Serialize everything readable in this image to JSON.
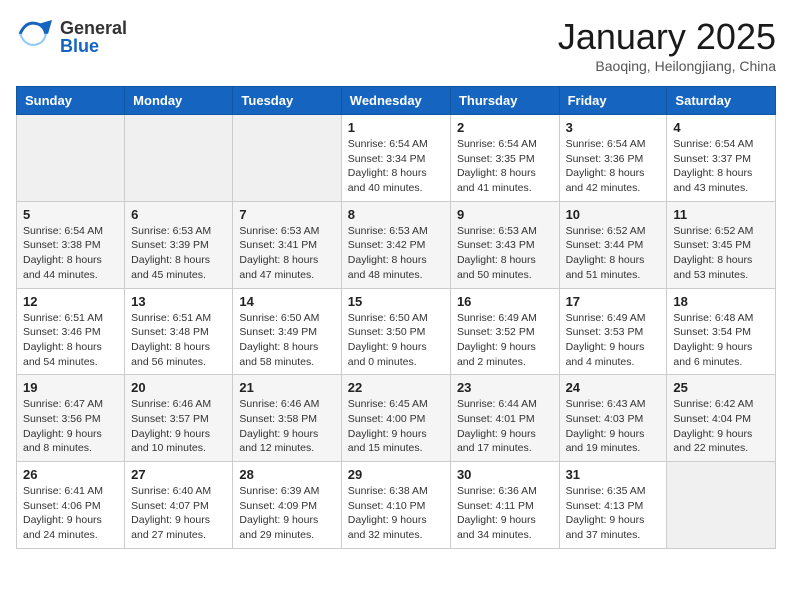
{
  "header": {
    "logo_general": "General",
    "logo_blue": "Blue",
    "month_title": "January 2025",
    "location": "Baoqing, Heilongjiang, China"
  },
  "days_of_week": [
    "Sunday",
    "Monday",
    "Tuesday",
    "Wednesday",
    "Thursday",
    "Friday",
    "Saturday"
  ],
  "weeks": [
    [
      {
        "day": "",
        "empty": true
      },
      {
        "day": "",
        "empty": true
      },
      {
        "day": "",
        "empty": true
      },
      {
        "day": "1",
        "sunrise": "6:54 AM",
        "sunset": "3:34 PM",
        "daylight": "8 hours and 40 minutes."
      },
      {
        "day": "2",
        "sunrise": "6:54 AM",
        "sunset": "3:35 PM",
        "daylight": "8 hours and 41 minutes."
      },
      {
        "day": "3",
        "sunrise": "6:54 AM",
        "sunset": "3:36 PM",
        "daylight": "8 hours and 42 minutes."
      },
      {
        "day": "4",
        "sunrise": "6:54 AM",
        "sunset": "3:37 PM",
        "daylight": "8 hours and 43 minutes."
      }
    ],
    [
      {
        "day": "5",
        "sunrise": "6:54 AM",
        "sunset": "3:38 PM",
        "daylight": "8 hours and 44 minutes."
      },
      {
        "day": "6",
        "sunrise": "6:53 AM",
        "sunset": "3:39 PM",
        "daylight": "8 hours and 45 minutes."
      },
      {
        "day": "7",
        "sunrise": "6:53 AM",
        "sunset": "3:41 PM",
        "daylight": "8 hours and 47 minutes."
      },
      {
        "day": "8",
        "sunrise": "6:53 AM",
        "sunset": "3:42 PM",
        "daylight": "8 hours and 48 minutes."
      },
      {
        "day": "9",
        "sunrise": "6:53 AM",
        "sunset": "3:43 PM",
        "daylight": "8 hours and 50 minutes."
      },
      {
        "day": "10",
        "sunrise": "6:52 AM",
        "sunset": "3:44 PM",
        "daylight": "8 hours and 51 minutes."
      },
      {
        "day": "11",
        "sunrise": "6:52 AM",
        "sunset": "3:45 PM",
        "daylight": "8 hours and 53 minutes."
      }
    ],
    [
      {
        "day": "12",
        "sunrise": "6:51 AM",
        "sunset": "3:46 PM",
        "daylight": "8 hours and 54 minutes."
      },
      {
        "day": "13",
        "sunrise": "6:51 AM",
        "sunset": "3:48 PM",
        "daylight": "8 hours and 56 minutes."
      },
      {
        "day": "14",
        "sunrise": "6:50 AM",
        "sunset": "3:49 PM",
        "daylight": "8 hours and 58 minutes."
      },
      {
        "day": "15",
        "sunrise": "6:50 AM",
        "sunset": "3:50 PM",
        "daylight": "9 hours and 0 minutes."
      },
      {
        "day": "16",
        "sunrise": "6:49 AM",
        "sunset": "3:52 PM",
        "daylight": "9 hours and 2 minutes."
      },
      {
        "day": "17",
        "sunrise": "6:49 AM",
        "sunset": "3:53 PM",
        "daylight": "9 hours and 4 minutes."
      },
      {
        "day": "18",
        "sunrise": "6:48 AM",
        "sunset": "3:54 PM",
        "daylight": "9 hours and 6 minutes."
      }
    ],
    [
      {
        "day": "19",
        "sunrise": "6:47 AM",
        "sunset": "3:56 PM",
        "daylight": "9 hours and 8 minutes."
      },
      {
        "day": "20",
        "sunrise": "6:46 AM",
        "sunset": "3:57 PM",
        "daylight": "9 hours and 10 minutes."
      },
      {
        "day": "21",
        "sunrise": "6:46 AM",
        "sunset": "3:58 PM",
        "daylight": "9 hours and 12 minutes."
      },
      {
        "day": "22",
        "sunrise": "6:45 AM",
        "sunset": "4:00 PM",
        "daylight": "9 hours and 15 minutes."
      },
      {
        "day": "23",
        "sunrise": "6:44 AM",
        "sunset": "4:01 PM",
        "daylight": "9 hours and 17 minutes."
      },
      {
        "day": "24",
        "sunrise": "6:43 AM",
        "sunset": "4:03 PM",
        "daylight": "9 hours and 19 minutes."
      },
      {
        "day": "25",
        "sunrise": "6:42 AM",
        "sunset": "4:04 PM",
        "daylight": "9 hours and 22 minutes."
      }
    ],
    [
      {
        "day": "26",
        "sunrise": "6:41 AM",
        "sunset": "4:06 PM",
        "daylight": "9 hours and 24 minutes."
      },
      {
        "day": "27",
        "sunrise": "6:40 AM",
        "sunset": "4:07 PM",
        "daylight": "9 hours and 27 minutes."
      },
      {
        "day": "28",
        "sunrise": "6:39 AM",
        "sunset": "4:09 PM",
        "daylight": "9 hours and 29 minutes."
      },
      {
        "day": "29",
        "sunrise": "6:38 AM",
        "sunset": "4:10 PM",
        "daylight": "9 hours and 32 minutes."
      },
      {
        "day": "30",
        "sunrise": "6:36 AM",
        "sunset": "4:11 PM",
        "daylight": "9 hours and 34 minutes."
      },
      {
        "day": "31",
        "sunrise": "6:35 AM",
        "sunset": "4:13 PM",
        "daylight": "9 hours and 37 minutes."
      },
      {
        "day": "",
        "empty": true
      }
    ]
  ]
}
